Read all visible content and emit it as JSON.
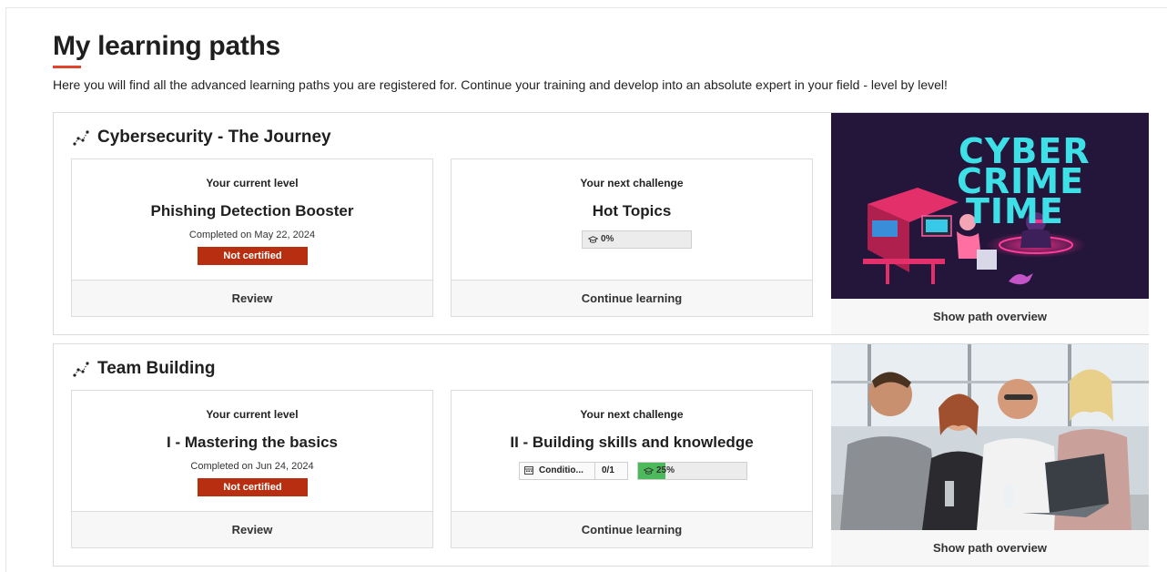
{
  "page": {
    "title": "My learning paths",
    "intro": "Here you will find all the advanced learning paths you are registered for. Continue your training and develop into an absolute expert in your field - level by level!"
  },
  "colors": {
    "accent": "#e0452b",
    "badge_red": "#b72f10",
    "progress_green": "#4cba5a"
  },
  "paths": [
    {
      "name": "Cybersecurity - The Journey",
      "icon": "path-nodes-icon",
      "current": {
        "kicker": "Your current level",
        "level": "Phishing Detection Booster",
        "completed": "Completed on May 22, 2024",
        "status": "Not certified",
        "action": "Review"
      },
      "next": {
        "kicker": "Your next challenge",
        "level": "Hot Topics",
        "progress_label": "0%",
        "progress": 0,
        "action": "Continue learning"
      },
      "image": {
        "text_line1": "CYBER",
        "text_line2": "CRIME",
        "text_line3": "TIME"
      },
      "overview_label": "Show path overview"
    },
    {
      "name": "Team Building",
      "icon": "path-nodes-icon",
      "current": {
        "kicker": "Your current level",
        "level": "I - Mastering the basics",
        "completed": "Completed on Jun 24, 2024",
        "status": "Not certified",
        "action": "Review"
      },
      "next": {
        "kicker": "Your next challenge",
        "level": "II - Building skills and knowledge",
        "condition_label": "Conditio...",
        "condition_count": "0/1",
        "progress_label": "25%",
        "progress": 0.25,
        "action": "Continue learning"
      },
      "overview_label": "Show path overview"
    }
  ]
}
